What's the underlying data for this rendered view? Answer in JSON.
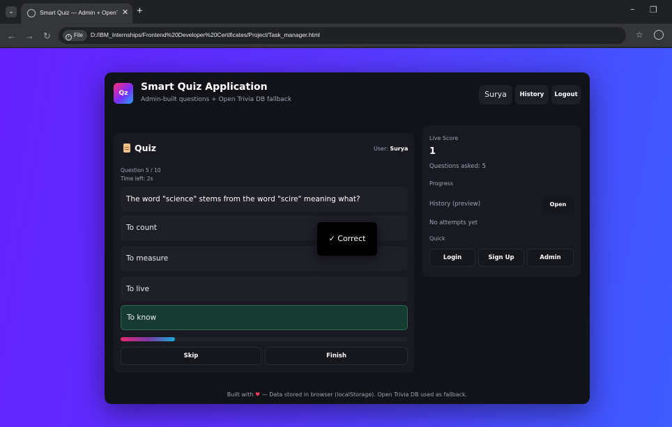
{
  "browser": {
    "tab_title": "Smart Quiz — Admin + OpenT",
    "url": "D:/IBM_Internships/Frontend%20Developer%20Certificates/Project/Task_manager.html",
    "url_chip": "File"
  },
  "header": {
    "logo_text": "Qz",
    "title": "Smart Quiz Application",
    "subtitle": "Admin-built questions + Open Trivia DB fallback",
    "user_name": "Surya",
    "history_label": "History",
    "logout_label": "Logout"
  },
  "quiz": {
    "title": "Quiz",
    "user_label": "User:",
    "user_name": "Surya",
    "question_counter": "Question 5 / 10",
    "time_left": "Time left: 2s",
    "question": "The word \"science\" stems from the word \"scire\" meaning what?",
    "options": [
      {
        "text": "To count",
        "state": "default"
      },
      {
        "text": "To measure",
        "state": "default"
      },
      {
        "text": "To live",
        "state": "default"
      },
      {
        "text": "To know",
        "state": "correct"
      }
    ],
    "progress_fraction": 0.19,
    "skip_label": "Skip",
    "finish_label": "Finish"
  },
  "toast": {
    "text": "✓ Correct"
  },
  "sidebar": {
    "live_score_label": "Live Score",
    "score": "1",
    "questions_asked": "Questions asked: 5",
    "progress_label": "Progress",
    "history_preview_label": "History (preview)",
    "open_label": "Open",
    "no_attempts": "No attempts yet",
    "quick_label": "Quick",
    "login_label": "Login",
    "signup_label": "Sign Up",
    "admin_label": "Admin"
  },
  "footer": {
    "prefix": "Built with",
    "heart": "♥",
    "suffix": "— Data stored in browser (localStorage). Open Trivia DB used as fallback."
  },
  "colors": {
    "background_start": "#6522ff",
    "background_end": "#3d5cff",
    "card": "#121318",
    "correct_option": "#173b31",
    "accent_pink": "#e6266d",
    "accent_blue": "#19a9d6"
  }
}
